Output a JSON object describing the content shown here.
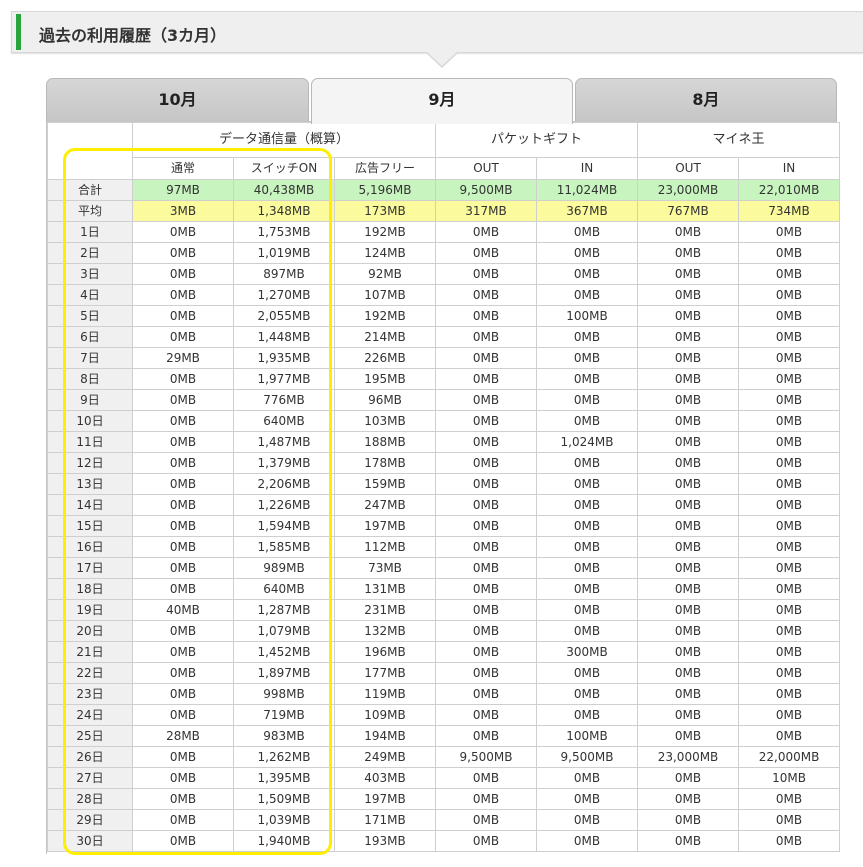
{
  "section": {
    "title": "過去の利用履歴（3カ月）"
  },
  "tabs": [
    {
      "label": "10月",
      "active": false
    },
    {
      "label": "9月",
      "active": true
    },
    {
      "label": "8月",
      "active": false
    }
  ],
  "table": {
    "groups": {
      "data": "データ通信量（概算）",
      "packet": "パケットギフト",
      "maine": "マイネ王"
    },
    "subheaders": [
      "通常",
      "スイッチON",
      "広告フリー",
      "OUT",
      "IN",
      "OUT",
      "IN"
    ],
    "summary": [
      {
        "label": "合計",
        "cells": [
          "97MB",
          "40,438MB",
          "5,196MB",
          "9,500MB",
          "11,024MB",
          "23,000MB",
          "22,010MB"
        ]
      },
      {
        "label": "平均",
        "cells": [
          "3MB",
          "1,348MB",
          "173MB",
          "317MB",
          "367MB",
          "767MB",
          "734MB"
        ]
      }
    ],
    "days": [
      {
        "label": "1日",
        "cells": [
          "0MB",
          "1,753MB",
          "192MB",
          "0MB",
          "0MB",
          "0MB",
          "0MB"
        ]
      },
      {
        "label": "2日",
        "cells": [
          "0MB",
          "1,019MB",
          "124MB",
          "0MB",
          "0MB",
          "0MB",
          "0MB"
        ]
      },
      {
        "label": "3日",
        "cells": [
          "0MB",
          "897MB",
          "92MB",
          "0MB",
          "0MB",
          "0MB",
          "0MB"
        ]
      },
      {
        "label": "4日",
        "cells": [
          "0MB",
          "1,270MB",
          "107MB",
          "0MB",
          "0MB",
          "0MB",
          "0MB"
        ]
      },
      {
        "label": "5日",
        "cells": [
          "0MB",
          "2,055MB",
          "192MB",
          "0MB",
          "100MB",
          "0MB",
          "0MB"
        ]
      },
      {
        "label": "6日",
        "cells": [
          "0MB",
          "1,448MB",
          "214MB",
          "0MB",
          "0MB",
          "0MB",
          "0MB"
        ]
      },
      {
        "label": "7日",
        "cells": [
          "29MB",
          "1,935MB",
          "226MB",
          "0MB",
          "0MB",
          "0MB",
          "0MB"
        ]
      },
      {
        "label": "8日",
        "cells": [
          "0MB",
          "1,977MB",
          "195MB",
          "0MB",
          "0MB",
          "0MB",
          "0MB"
        ]
      },
      {
        "label": "9日",
        "cells": [
          "0MB",
          "776MB",
          "96MB",
          "0MB",
          "0MB",
          "0MB",
          "0MB"
        ]
      },
      {
        "label": "10日",
        "cells": [
          "0MB",
          "640MB",
          "103MB",
          "0MB",
          "0MB",
          "0MB",
          "0MB"
        ]
      },
      {
        "label": "11日",
        "cells": [
          "0MB",
          "1,487MB",
          "188MB",
          "0MB",
          "1,024MB",
          "0MB",
          "0MB"
        ]
      },
      {
        "label": "12日",
        "cells": [
          "0MB",
          "1,379MB",
          "178MB",
          "0MB",
          "0MB",
          "0MB",
          "0MB"
        ]
      },
      {
        "label": "13日",
        "cells": [
          "0MB",
          "2,206MB",
          "159MB",
          "0MB",
          "0MB",
          "0MB",
          "0MB"
        ]
      },
      {
        "label": "14日",
        "cells": [
          "0MB",
          "1,226MB",
          "247MB",
          "0MB",
          "0MB",
          "0MB",
          "0MB"
        ]
      },
      {
        "label": "15日",
        "cells": [
          "0MB",
          "1,594MB",
          "197MB",
          "0MB",
          "0MB",
          "0MB",
          "0MB"
        ]
      },
      {
        "label": "16日",
        "cells": [
          "0MB",
          "1,585MB",
          "112MB",
          "0MB",
          "0MB",
          "0MB",
          "0MB"
        ]
      },
      {
        "label": "17日",
        "cells": [
          "0MB",
          "989MB",
          "73MB",
          "0MB",
          "0MB",
          "0MB",
          "0MB"
        ]
      },
      {
        "label": "18日",
        "cells": [
          "0MB",
          "640MB",
          "131MB",
          "0MB",
          "0MB",
          "0MB",
          "0MB"
        ]
      },
      {
        "label": "19日",
        "cells": [
          "40MB",
          "1,287MB",
          "231MB",
          "0MB",
          "0MB",
          "0MB",
          "0MB"
        ]
      },
      {
        "label": "20日",
        "cells": [
          "0MB",
          "1,079MB",
          "132MB",
          "0MB",
          "0MB",
          "0MB",
          "0MB"
        ]
      },
      {
        "label": "21日",
        "cells": [
          "0MB",
          "1,452MB",
          "196MB",
          "0MB",
          "300MB",
          "0MB",
          "0MB"
        ]
      },
      {
        "label": "22日",
        "cells": [
          "0MB",
          "1,897MB",
          "177MB",
          "0MB",
          "0MB",
          "0MB",
          "0MB"
        ]
      },
      {
        "label": "23日",
        "cells": [
          "0MB",
          "998MB",
          "119MB",
          "0MB",
          "0MB",
          "0MB",
          "0MB"
        ]
      },
      {
        "label": "24日",
        "cells": [
          "0MB",
          "719MB",
          "109MB",
          "0MB",
          "0MB",
          "0MB",
          "0MB"
        ]
      },
      {
        "label": "25日",
        "cells": [
          "28MB",
          "983MB",
          "194MB",
          "0MB",
          "100MB",
          "0MB",
          "0MB"
        ]
      },
      {
        "label": "26日",
        "cells": [
          "0MB",
          "1,262MB",
          "249MB",
          "9,500MB",
          "9,500MB",
          "23,000MB",
          "22,000MB"
        ]
      },
      {
        "label": "27日",
        "cells": [
          "0MB",
          "1,395MB",
          "403MB",
          "0MB",
          "0MB",
          "0MB",
          "10MB"
        ]
      },
      {
        "label": "28日",
        "cells": [
          "0MB",
          "1,509MB",
          "197MB",
          "0MB",
          "0MB",
          "0MB",
          "0MB"
        ]
      },
      {
        "label": "29日",
        "cells": [
          "0MB",
          "1,039MB",
          "171MB",
          "0MB",
          "0MB",
          "0MB",
          "0MB"
        ]
      },
      {
        "label": "30日",
        "cells": [
          "0MB",
          "1,940MB",
          "193MB",
          "0MB",
          "0MB",
          "0MB",
          "0MB"
        ]
      }
    ]
  },
  "colors": {
    "accent": "#27a53a",
    "sum_row": "#c8f5bf",
    "avg_row": "#fbfb9d",
    "highlight": "#ffee00"
  }
}
